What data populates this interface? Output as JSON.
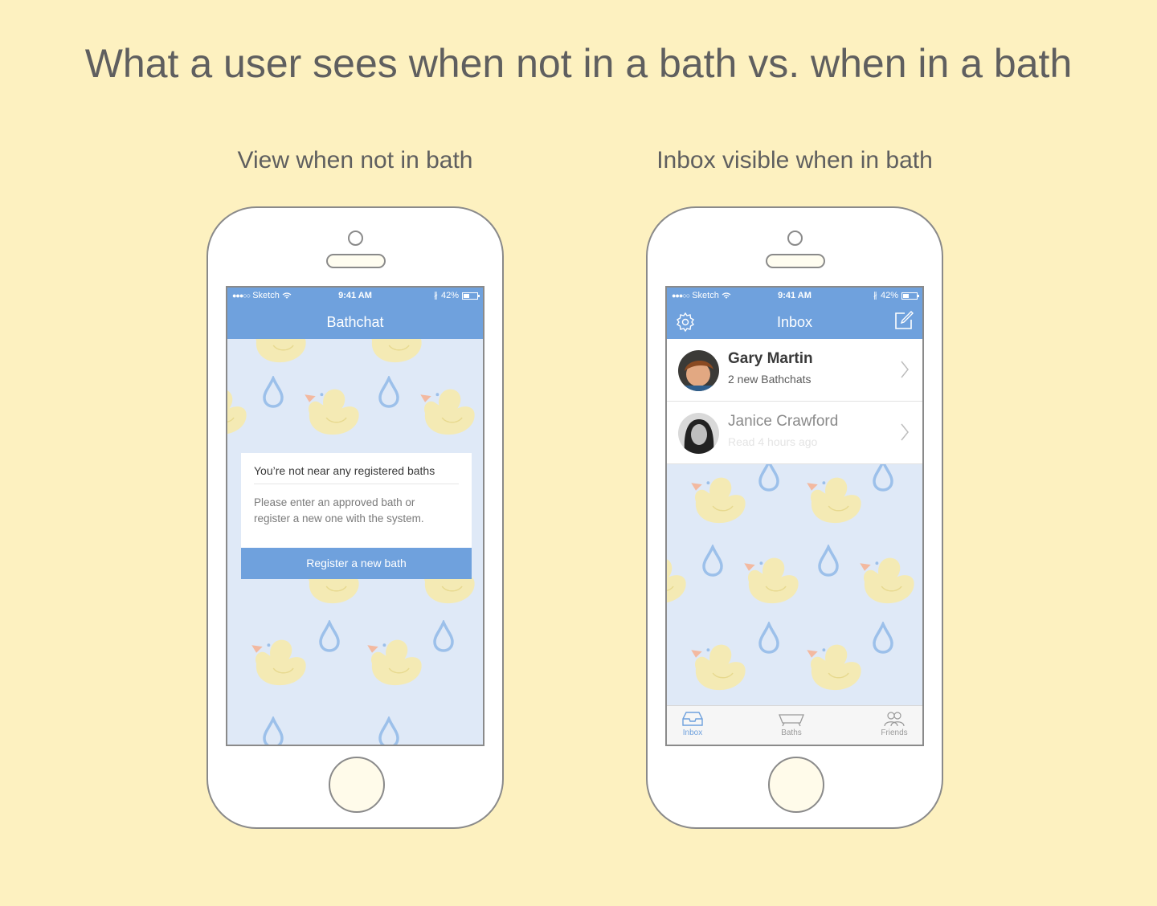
{
  "page": {
    "title": "What a user sees when not in a bath vs. when in a bath",
    "left_caption": "View when not in bath",
    "right_caption": "Inbox visible when in bath"
  },
  "colors": {
    "background": "#fdf1c0",
    "accent": "#6fa1dd",
    "screen_pattern": "#dfe9f7",
    "duck": "#f4eab4",
    "droplet": "#9cc0ea"
  },
  "status_bar": {
    "carrier": "Sketch",
    "time": "9:41 AM",
    "battery": "42%",
    "battery_level": 0.42
  },
  "left_phone": {
    "nav_title": "Bathchat",
    "card": {
      "heading": "You’re not near any registered baths",
      "body_line1": "Please enter an approved bath or",
      "body_line2": "register a new one with the system.",
      "button_label": "Register a new bath"
    }
  },
  "right_phone": {
    "nav_title": "Inbox",
    "nav_left_icon": "settings-gear-icon",
    "nav_right_icon": "compose-icon",
    "conversations": [
      {
        "name": "Gary Martin",
        "detail": "2 new Bathchats",
        "unread": true
      },
      {
        "name": "Janice Crawford",
        "detail": "Read 4 hours ago",
        "unread": false
      }
    ],
    "tabs": [
      {
        "label": "Inbox",
        "icon": "inbox-icon",
        "active": true
      },
      {
        "label": "Baths",
        "icon": "bathtub-icon",
        "active": false
      },
      {
        "label": "Friends",
        "icon": "friends-icon",
        "active": false
      }
    ]
  }
}
